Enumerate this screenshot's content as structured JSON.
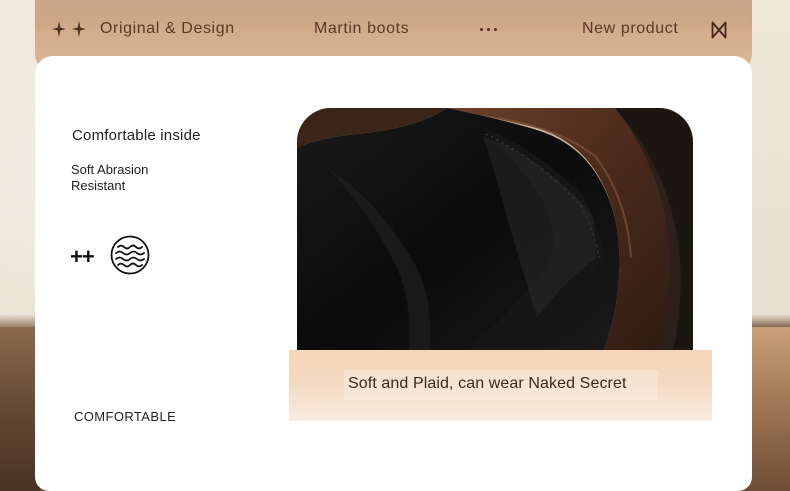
{
  "nav": {
    "items": [
      "Original & Design",
      "Martin boots",
      "New product"
    ],
    "colors": {
      "band": "#d3ad8b",
      "text": "#5a3a24"
    },
    "icons": [
      "sparkle-star-icon",
      "more-dots-icon",
      "bowtie-icon"
    ]
  },
  "feature": {
    "title": "Comfortable inside",
    "description": "Soft Abrasion Resistant",
    "plus_symbol": "++",
    "icon": "waves-icon",
    "label": "COMFORTABLE"
  },
  "caption": {
    "text": "Soft and Plaid, can wear Naked Secret",
    "colors": {
      "bar_top": "#f6d6b8",
      "bar_bottom": "#f9ece0"
    }
  }
}
